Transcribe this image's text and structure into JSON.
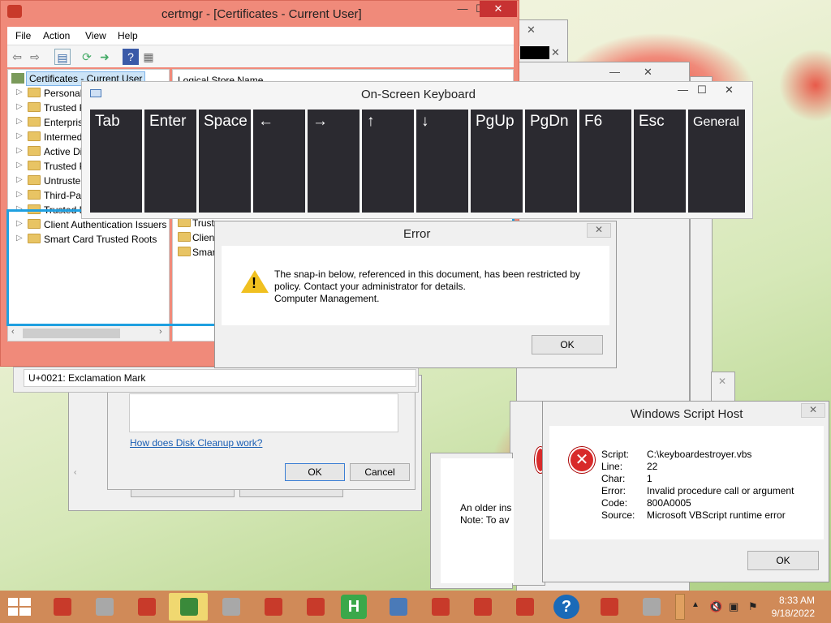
{
  "certmgr": {
    "title": "certmgr - [Certificates - Current User]",
    "menu": [
      "File",
      "Action",
      "View",
      "Help"
    ],
    "tree_root": "Certificates - Current User",
    "tree_items": [
      "Personal",
      "Trusted R",
      "Enterpris",
      "Intermed",
      "Active Di",
      "Trusted P",
      "Untruste",
      "Third-Pa",
      "Trusted F",
      "Client Authentication Issuers",
      "Smart Card Trusted Roots"
    ],
    "right_header": "Logical Store Name",
    "right_items": [
      "Trust",
      "Client",
      "Smart"
    ]
  },
  "osk": {
    "title": "On-Screen Keyboard",
    "keys": [
      "Tab",
      "Enter",
      "Space",
      "←",
      "→",
      "↑",
      "↓",
      "PgUp",
      "PgDn",
      "F6",
      "Esc",
      "General"
    ]
  },
  "error_dialog": {
    "title": "Error",
    "line1": "The snap-in below, referenced in this document, has been restricted by",
    "line2": "policy. Contact your administrator for details.",
    "line3": "Computer Management.",
    "ok": "OK"
  },
  "charmap": {
    "status": "U+0021: Exclamation Mark"
  },
  "disk_cleanup": {
    "link": "How does Disk Cleanup work?",
    "ok": "OK",
    "cancel": "Cancel"
  },
  "older_dialog": {
    "line1": "An older ins",
    "line2": "Note: To av"
  },
  "wsh": {
    "title": "Windows Script Host",
    "labels": [
      "Script:",
      "Line:",
      "Char:",
      "Error:",
      "Code:",
      "Source:"
    ],
    "values": [
      "C:\\keyboardestroyer.vbs",
      "22",
      "1",
      "Invalid procedure call or argument",
      "800A0005",
      "Microsoft VBScript runtime error"
    ],
    "ok": "OK"
  },
  "taskbar": {
    "time": "8:33 AM",
    "date": "9/18/2022",
    "icons": [
      "start-icon",
      "toolbox-icon",
      "printer-icon",
      "toolbox-icon",
      "cash-register-icon",
      "printer-icon",
      "toolbox-icon",
      "toolbox-icon",
      "performance-monitor-icon",
      "h-app-icon",
      "keyboard-icon",
      "toolbox-icon",
      "toolbox-icon",
      "toolbox-icon",
      "help-icon",
      "toolbox-icon",
      "printer-icon"
    ]
  },
  "colors": {
    "certmgr_frame": "#f08a7a",
    "taskbar": "#d08a58",
    "osk_key": "#2b2a30",
    "selection": "#1fa0e0"
  }
}
